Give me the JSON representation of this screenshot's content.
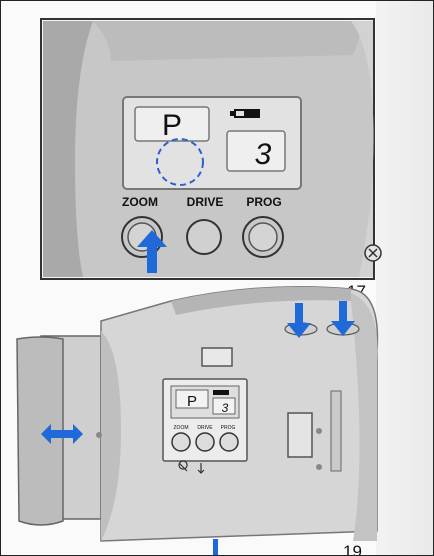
{
  "top_illustration": {
    "mode_letter": "P",
    "frame_count": "3",
    "buttons": [
      "ZOOM",
      "DRIVE",
      "PROG"
    ]
  },
  "bottom_illustration": {
    "mode_letter": "P",
    "frame_count": "3",
    "buttons": [
      "ZOOM",
      "DRIVE",
      "PROG"
    ]
  },
  "page_numbers": {
    "first": "17",
    "second": "19"
  },
  "colors": {
    "accent": "#1f6ad8",
    "dashed_circle": "#2f5fd1",
    "body_gray": "#bdbdbd"
  }
}
